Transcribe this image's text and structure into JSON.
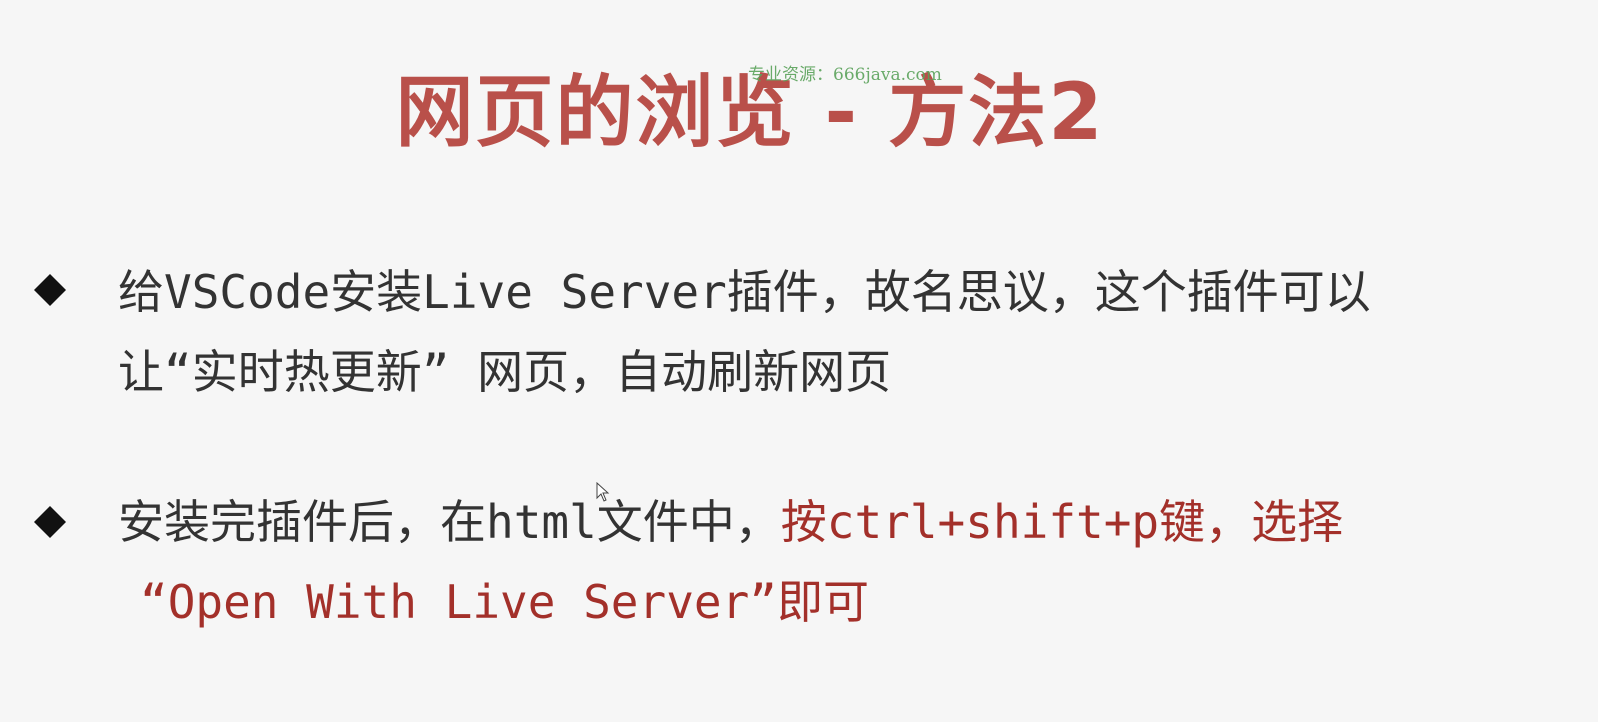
{
  "slide": {
    "title": "网页的浏览 - 方法2",
    "watermark": "专业资源：666java.com",
    "bullets": [
      {
        "line1": "给VSCode安装Live Server插件，故名思议，这个插件可以",
        "line2": "让“实时热更新”  网页，自动刷新网页"
      },
      {
        "line1_plain": "安装完插件后，在html文件中，",
        "line1_red": "按ctrl+shift+p键，选择",
        "line2_red": "“Open With Live Server”即可"
      }
    ]
  },
  "colors": {
    "title": "#b9504a",
    "body_text": "#333333",
    "highlight": "#a3302a",
    "watermark": "#5aa25a",
    "background": "#f6f6f6"
  },
  "icons": [
    "diamond-bullet-icon",
    "mouse-cursor-icon"
  ]
}
